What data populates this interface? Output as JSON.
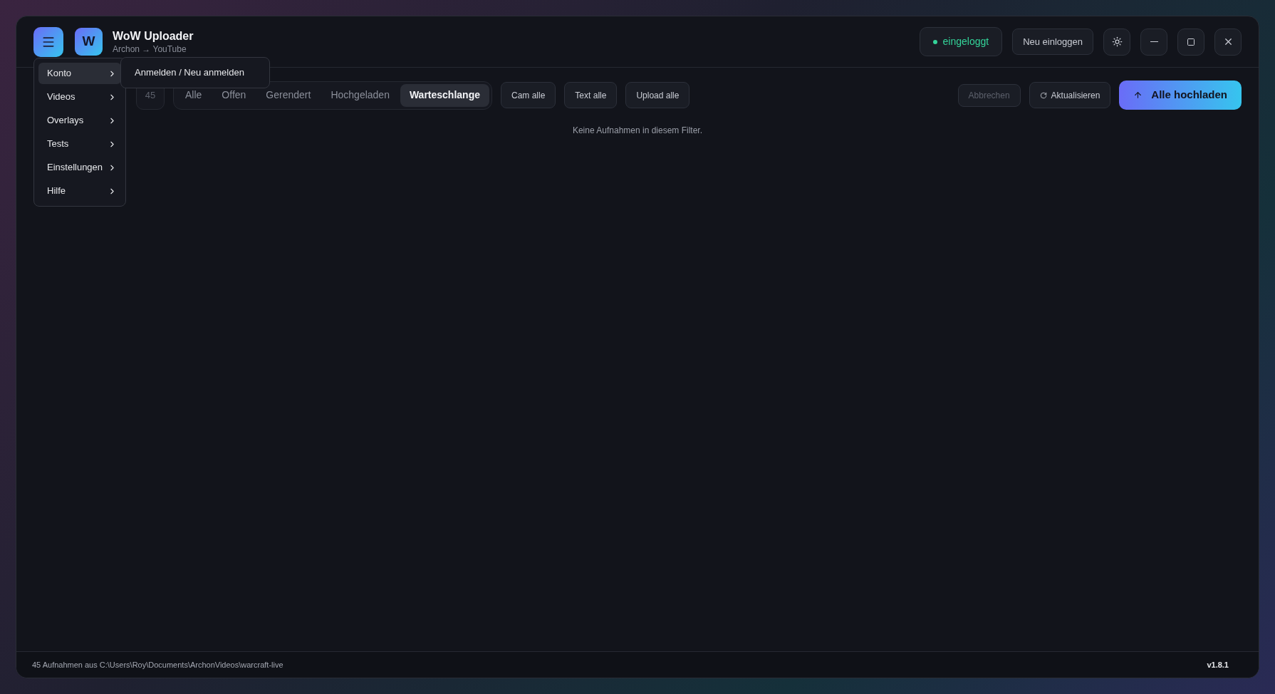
{
  "app": {
    "logo_letter": "W",
    "title": "WoW Uploader",
    "subtitle": "Archon → YouTube"
  },
  "header": {
    "status": {
      "label": "eingeloggt",
      "color": "#34d399"
    },
    "relogin": "Neu einloggen"
  },
  "menu": {
    "items": [
      {
        "label": "Konto",
        "selected": true
      },
      {
        "label": "Videos",
        "selected": false
      },
      {
        "label": "Overlays",
        "selected": false
      },
      {
        "label": "Tests",
        "selected": false
      },
      {
        "label": "Einstellungen",
        "selected": false
      },
      {
        "label": "Hilfe",
        "selected": false
      }
    ],
    "submenu": [
      "Anmelden / Neu anmelden"
    ]
  },
  "toolbar": {
    "count": "45",
    "filters": [
      {
        "label": "Alle",
        "selected": false
      },
      {
        "label": "Offen",
        "selected": false
      },
      {
        "label": "Gerendert",
        "selected": false
      },
      {
        "label": "Hochgeladen",
        "selected": false
      },
      {
        "label": "Warteschlange",
        "selected": true
      }
    ],
    "bulk": [
      "Cam alle",
      "Text alle",
      "Upload alle"
    ],
    "cancel": {
      "label": "Abbrechen",
      "disabled": true
    },
    "refresh": "Aktualisieren",
    "upload_all": "Alle hochladen"
  },
  "empty_message": "Keine Aufnahmen in diesem Filter.",
  "status_bar": {
    "path": "45 Aufnahmen aus C:\\Users\\Roy\\Documents\\ArchonVideos\\warcraft-live",
    "version": "v1.8.1"
  }
}
